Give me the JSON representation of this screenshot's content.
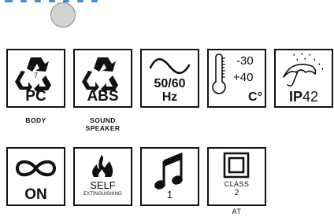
{
  "row1": {
    "pc": {
      "label": "PC",
      "number": "7",
      "caption": "BODY"
    },
    "abs": {
      "label": "ABS",
      "caption_line1": "SOUND",
      "caption_line2": "SPEAKER"
    },
    "frequency": {
      "value": "50/60",
      "unit": "Hz"
    },
    "temperature": {
      "min": "-30",
      "max": "+40",
      "unit": "C°"
    },
    "ip": {
      "prefix": "IP",
      "rating": "42"
    }
  },
  "row2": {
    "continuous": {
      "label": "ON"
    },
    "flame": {
      "line1": "SELF",
      "line2": "EXTINGUISHING"
    },
    "tone": {
      "value": "1"
    },
    "insulation": {
      "line1": "CLASS",
      "line2": "2",
      "caption": "AT"
    }
  }
}
